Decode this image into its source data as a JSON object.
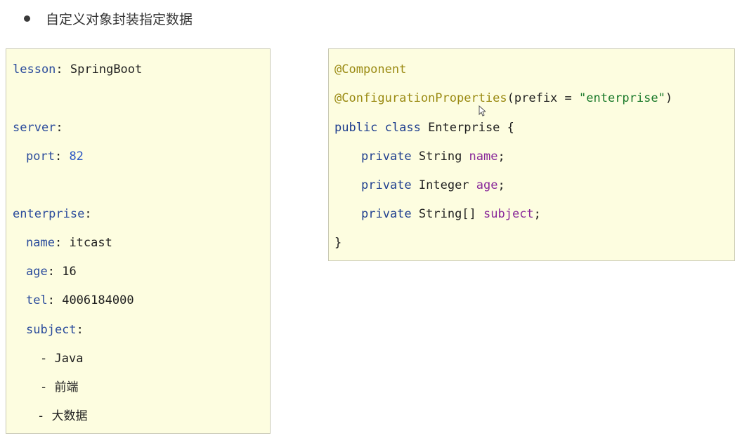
{
  "heading": "自定义对象封装指定数据",
  "yaml": {
    "lesson": {
      "key": "lesson",
      "value": "SpringBoot"
    },
    "server": {
      "key": "server"
    },
    "port": {
      "key": "port",
      "value": "82"
    },
    "enterprise": {
      "key": "enterprise"
    },
    "name": {
      "key": "name",
      "value": "itcast"
    },
    "age": {
      "key": "age",
      "value": "16"
    },
    "tel": {
      "key": "tel",
      "value": "4006184000"
    },
    "subject": {
      "key": "subject"
    },
    "subject_items": [
      "Java",
      "前端",
      "大数据"
    ]
  },
  "java": {
    "annotation1": "@Component",
    "annotation2": "@ConfigurationProperties",
    "prefix_open": "(prefix = ",
    "prefix_value": "\"enterprise\"",
    "prefix_close": ")",
    "class_kw": "public class",
    "class_name": " Enterprise {",
    "field1_kw": "private",
    "field1_type": " String ",
    "field1_name": "name",
    "field2_kw": "private",
    "field2_type": " Integer ",
    "field2_name": "age",
    "field3_kw": "private",
    "field3_type": " String[] ",
    "field3_name": "subject",
    "semicolon": ";",
    "closing_brace": "}"
  }
}
